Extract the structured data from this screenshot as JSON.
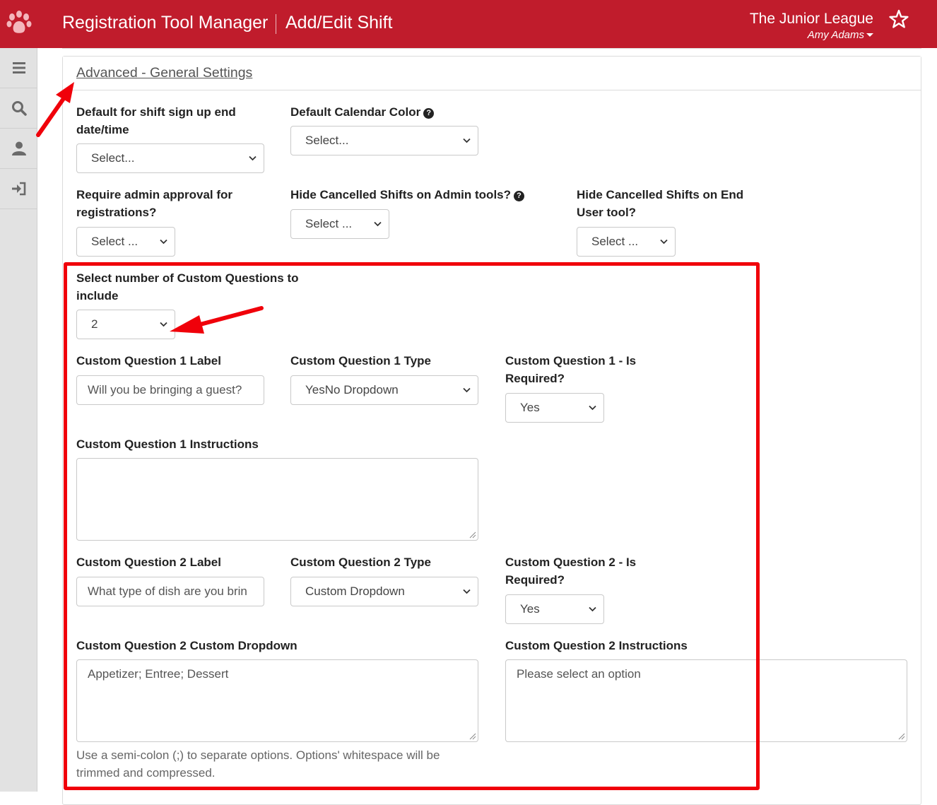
{
  "header": {
    "app_title": "Registration Tool Manager",
    "page_title": "Add/Edit Shift",
    "org_name": "The Junior League",
    "user_name": "Amy Adams",
    "brand_color": "#c01c2c"
  },
  "sidebar": {
    "items": [
      {
        "icon": "menu-icon"
      },
      {
        "icon": "search-icon"
      },
      {
        "icon": "user-icon"
      },
      {
        "icon": "sign-out-icon"
      }
    ]
  },
  "panel": {
    "heading": "Advanced - General Settings"
  },
  "fields": {
    "signup_end": {
      "label": "Default for shift sign up end date/time",
      "value": "Select..."
    },
    "calendar_color": {
      "label": "Default Calendar Color",
      "value": "Select..."
    },
    "admin_approval": {
      "label": "Require admin approval for registrations?",
      "value": "Select ..."
    },
    "hide_cancelled_admin": {
      "label": "Hide Cancelled Shifts on Admin tools?",
      "value": "Select ..."
    },
    "hide_cancelled_end_user": {
      "label": "Hide Cancelled Shifts on End User tool?",
      "value": "Select ..."
    },
    "num_custom_questions": {
      "label": "Select number of Custom Questions to include",
      "value": "2"
    },
    "cq1_label": {
      "label": "Custom Question 1 Label",
      "value": "Will you be bringing a guest?"
    },
    "cq1_type": {
      "label": "Custom Question 1 Type",
      "value": "YesNo Dropdown"
    },
    "cq1_required": {
      "label": "Custom Question 1 - Is Required?",
      "value": "Yes"
    },
    "cq1_instructions": {
      "label": "Custom Question 1 Instructions",
      "value": ""
    },
    "cq2_label": {
      "label": "Custom Question 2 Label",
      "value": "What type of dish are you brin"
    },
    "cq2_type": {
      "label": "Custom Question 2 Type",
      "value": "Custom Dropdown"
    },
    "cq2_required": {
      "label": "Custom Question 2 - Is Required?",
      "value": "Yes"
    },
    "cq2_dropdown": {
      "label": "Custom Question 2 Custom Dropdown",
      "value": "Appetizer; Entree; Dessert",
      "help": "Use a semi-colon (;) to separate options. Options' whitespace will be trimmed and compressed."
    },
    "cq2_instructions": {
      "label": "Custom Question 2 Instructions",
      "value": "Please select an option"
    }
  },
  "annotations": {
    "highlight_color": "#f0000a"
  }
}
